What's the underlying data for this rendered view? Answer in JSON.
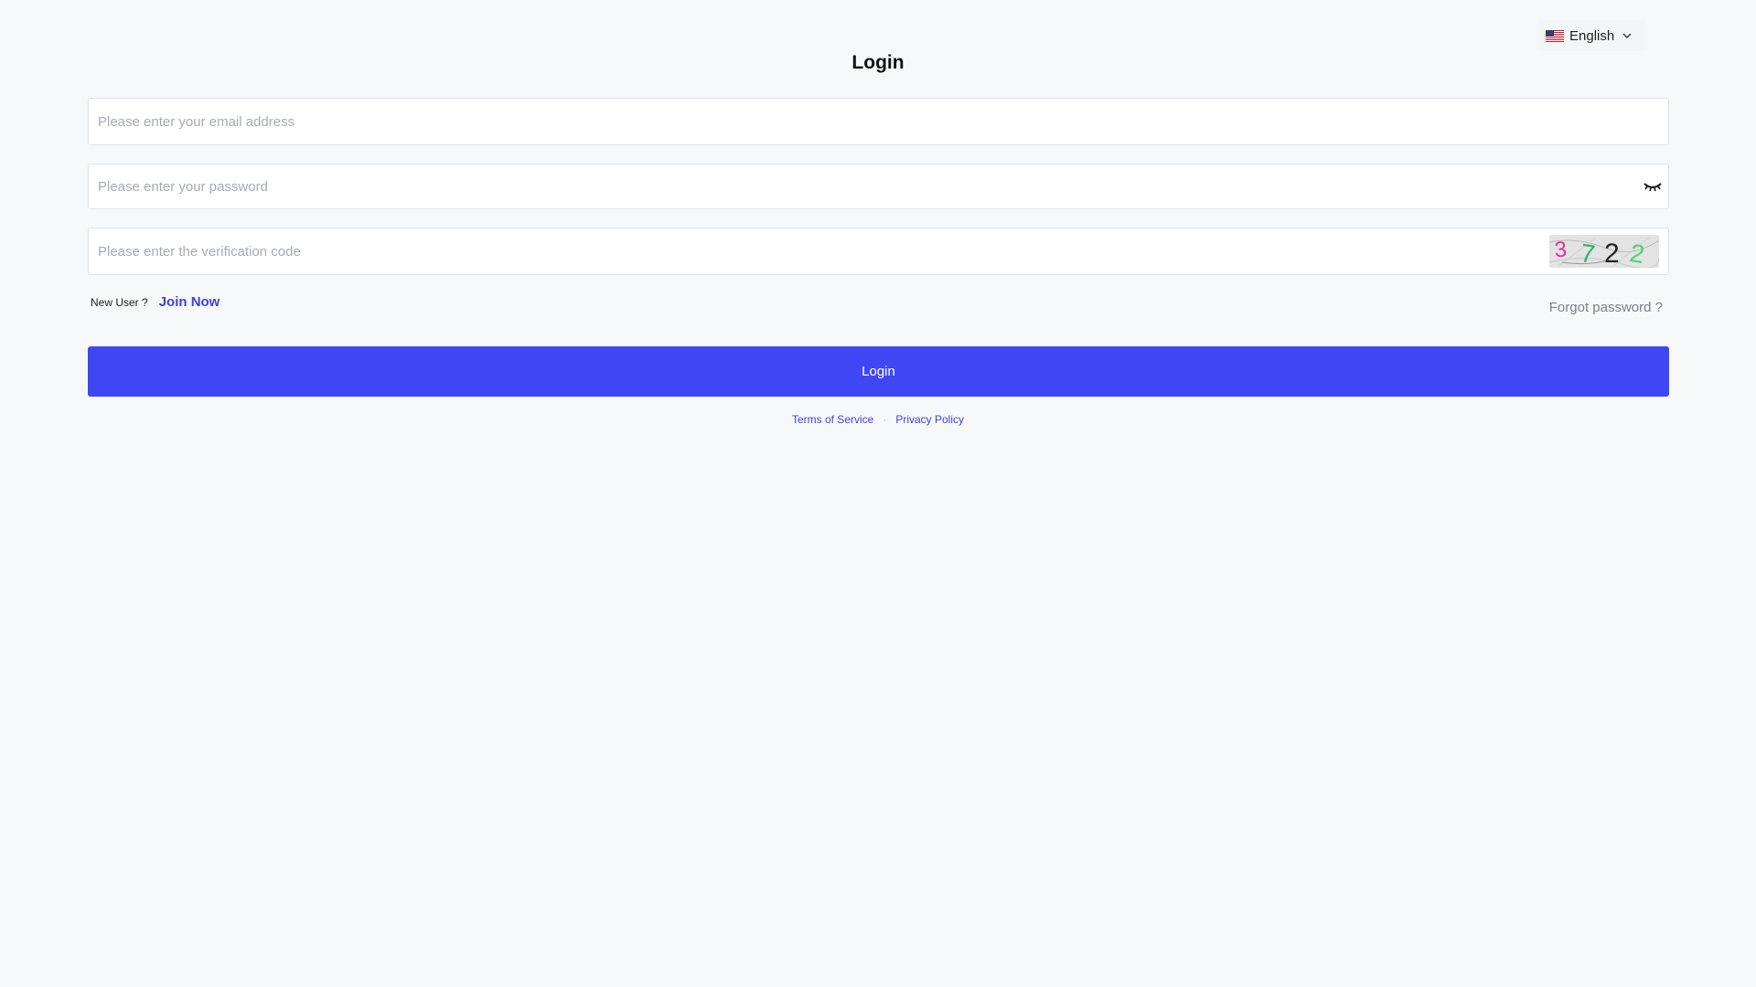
{
  "language": {
    "selected": "English",
    "flag_icon": "us-flag-icon"
  },
  "page": {
    "title": "Login"
  },
  "form": {
    "email": {
      "placeholder": "Please enter your email address",
      "value": ""
    },
    "password": {
      "placeholder": "Please enter your password",
      "value": "",
      "toggle_icon": "eye-closed-icon"
    },
    "verification": {
      "placeholder": "Please enter the verification code",
      "value": "",
      "captcha_text": "3722"
    },
    "new_user_label": "New User ?",
    "join_now": "Join Now",
    "forgot_password": "Forgot password ?",
    "submit_label": "Login"
  },
  "footer": {
    "terms": "Terms of Service",
    "separator": "·",
    "privacy": "Privacy Policy"
  },
  "colors": {
    "primary": "#3f47f5",
    "link": "#3d42d8",
    "background": "#f7f8fa"
  }
}
